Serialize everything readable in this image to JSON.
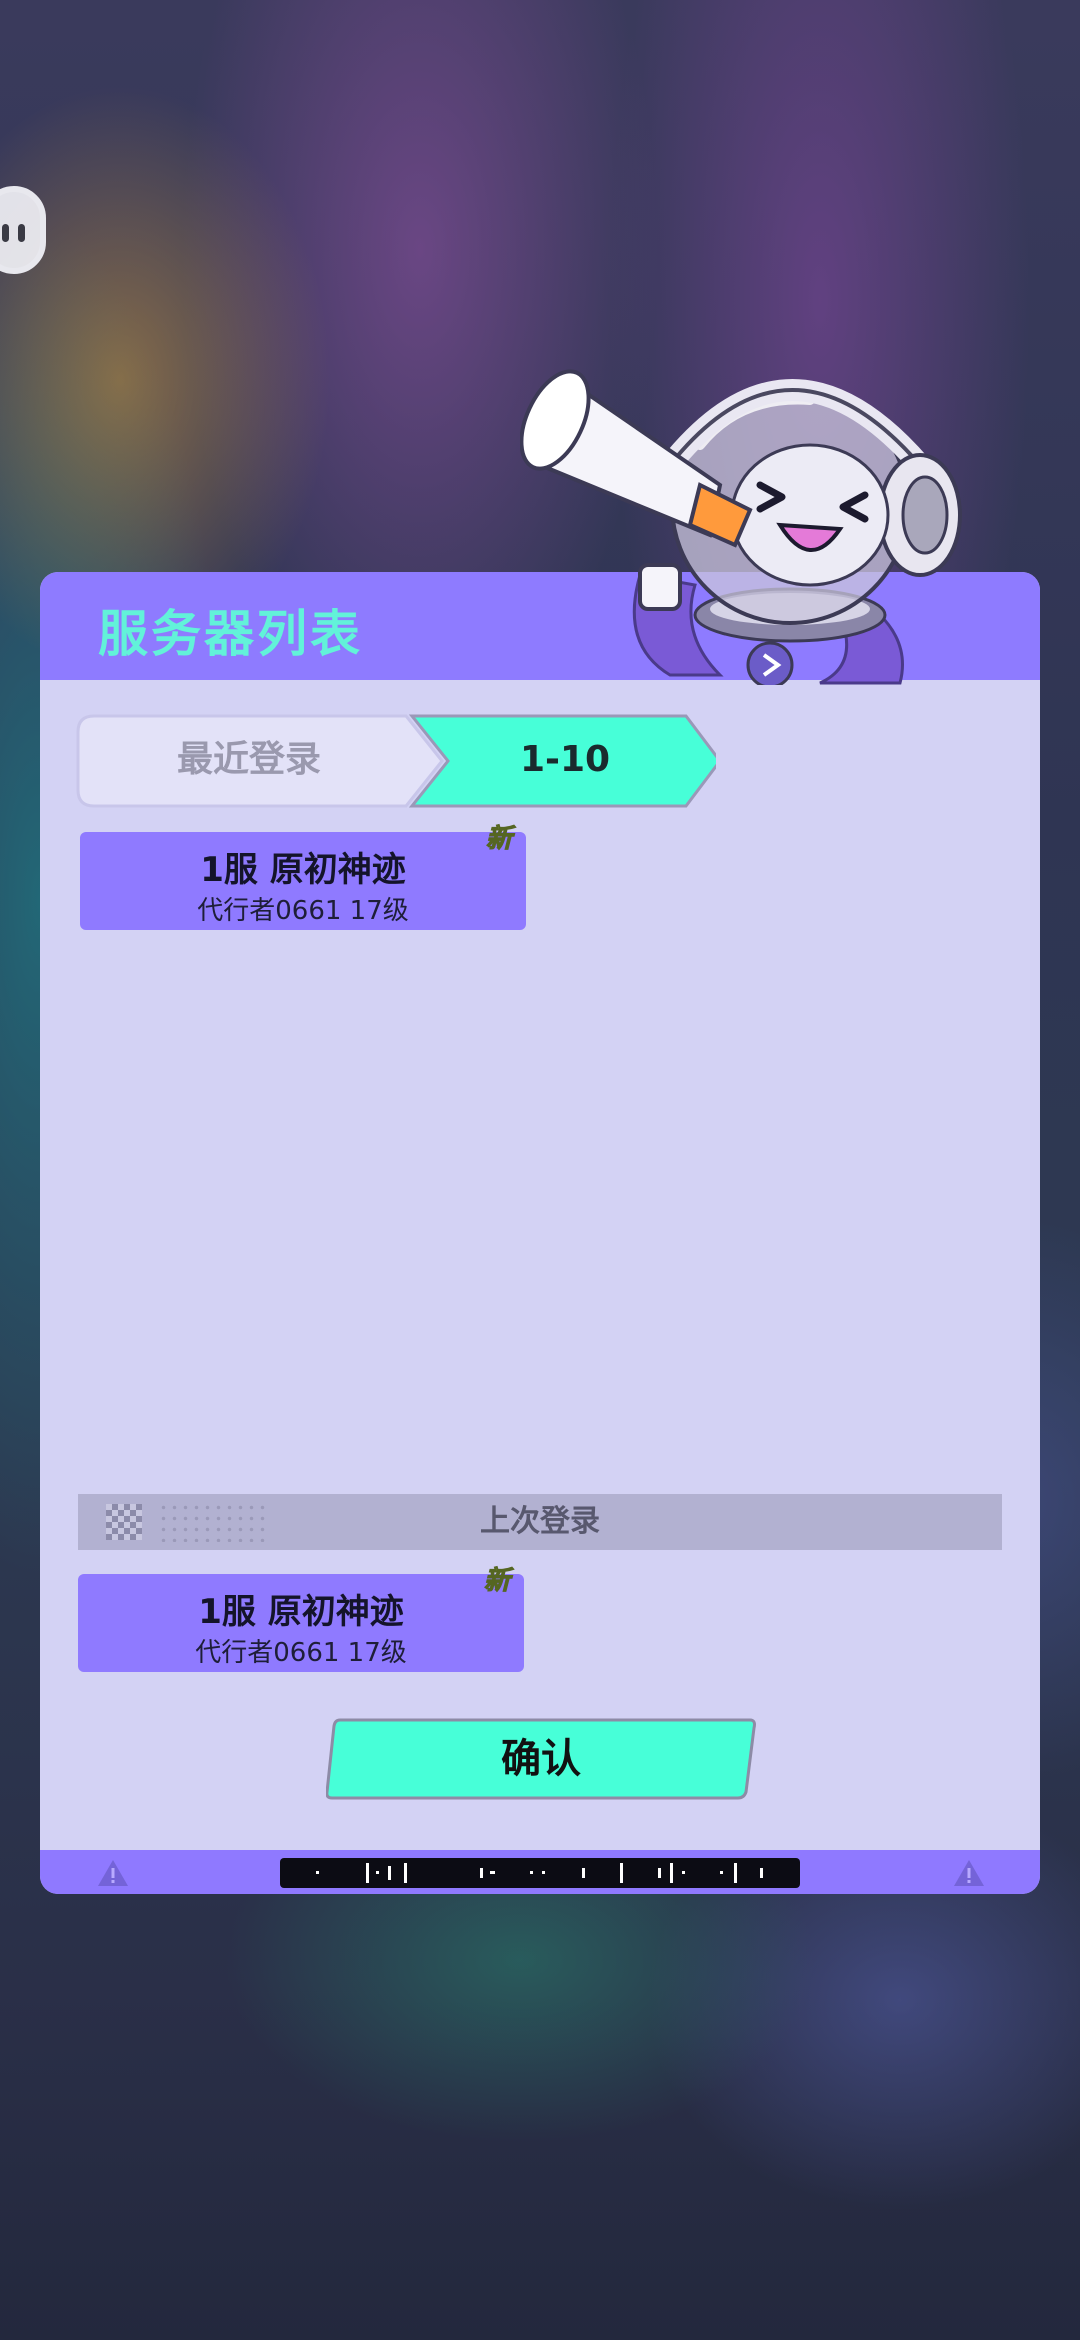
{
  "panel": {
    "title": "服务器列表",
    "tabs": [
      {
        "label": "最近登录",
        "active": false
      },
      {
        "label": "1-10",
        "active": true
      }
    ]
  },
  "server_list": [
    {
      "name": "1服 原初神迹",
      "player": "代行者0661 17级",
      "badge": "新"
    }
  ],
  "last_login": {
    "label": "上次登录",
    "server": {
      "name": "1服 原初神迹",
      "player": "代行者0661 17级",
      "badge": "新"
    }
  },
  "confirm_label": "确认",
  "colors": {
    "header": "#8e7bff",
    "panel_bg": "#d3d2f4",
    "accent_teal": "#47ffd8",
    "card": "#8f7aff",
    "badge": "#c9ff4a"
  },
  "icons": [
    "floating-assistant-icon",
    "megaphone-mascot",
    "warning-icon"
  ]
}
